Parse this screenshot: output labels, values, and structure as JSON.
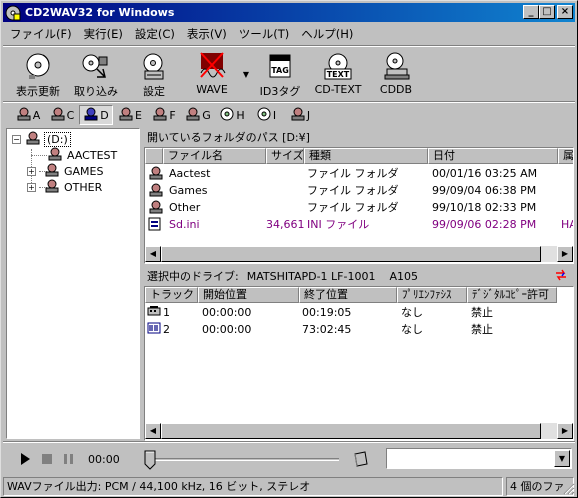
{
  "window": {
    "title": "CD2WAV32 for Windows"
  },
  "menu": [
    "ファイル(F)",
    "実行(E)",
    "設定(C)",
    "表示(V)",
    "ツール(T)",
    "ヘルプ(H)"
  ],
  "toolbar": {
    "refresh": "表示更新",
    "rip": "取り込み",
    "settings": "設定",
    "wave": "WAVE",
    "id3": "ID3タグ",
    "cdtext": "CD-TEXT",
    "cddb": "CDDB"
  },
  "drives": [
    "A",
    "C",
    "D",
    "E",
    "F",
    "G",
    "H",
    "I",
    "J"
  ],
  "tree": {
    "root": "(D:)",
    "children": [
      "AACTEST",
      "GAMES",
      "OTHER"
    ]
  },
  "folder_pane": {
    "title": "開いているフォルダのパス [D:¥]",
    "columns": [
      "ファイル名",
      "サイズ",
      "種類",
      "日付",
      "属"
    ],
    "rows": [
      {
        "name": "Aactest",
        "size": "",
        "type": "ファイル フォルダ",
        "date": "00/01/16 03:25 AM",
        "attr": ""
      },
      {
        "name": "Games",
        "size": "",
        "type": "ファイル フォルダ",
        "date": "99/09/04 06:38 PM",
        "attr": ""
      },
      {
        "name": "Other",
        "size": "",
        "type": "ファイル フォルダ",
        "date": "99/10/18 02:33 PM",
        "attr": ""
      },
      {
        "name": "Sd.ini",
        "size": "34,661",
        "type": "INI ファイル",
        "date": "99/09/06 02:28 PM",
        "attr": "HA"
      }
    ]
  },
  "drive_pane": {
    "label": "選択中のドライブ:",
    "drive_name": "MATSHITAPD-1 LF-1001",
    "revision": "A105",
    "columns": [
      "トラック",
      "開始位置",
      "終了位置",
      "ﾌﾟﾘｴﾝﾌｧｼｽ",
      "ﾃﾞｼﾞﾀﾙｺﾋﾟｰ許可"
    ],
    "rows": [
      {
        "track": "1",
        "start": "00:00:00",
        "end": "00:19:05",
        "pre": "なし",
        "copy": "禁止"
      },
      {
        "track": "2",
        "start": "00:00:00",
        "end": "73:02:45",
        "pre": "なし",
        "copy": "禁止"
      }
    ]
  },
  "player": {
    "time": "00:00"
  },
  "status": {
    "left": "WAVファイル出力: PCM / 44,100 kHz, 16 ビット, ステレオ",
    "right": "4 個のファ"
  },
  "colors": {
    "selected_file": "#800080",
    "title_start": "#000080",
    "title_end": "#1084d0"
  }
}
